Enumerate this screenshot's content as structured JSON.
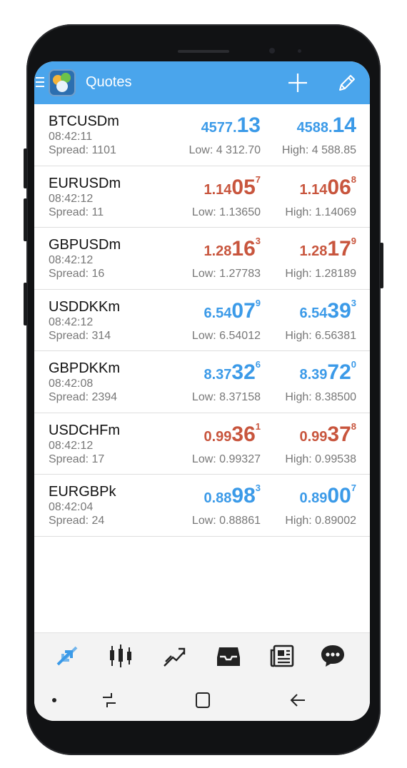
{
  "header": {
    "title": "Quotes",
    "menu_icon": "hamburger-icon",
    "logo_icon": "metatrader-logo-icon",
    "add_icon": "plus-icon",
    "edit_icon": "pencil-icon"
  },
  "colors": {
    "accent": "#4aa5ec",
    "up": "#3b9ae8",
    "down": "#c8553d"
  },
  "quotes": [
    {
      "symbol": "BTCUSDm",
      "time": "08:42:11",
      "spread": "Spread: 1101",
      "direction": "up",
      "bid": {
        "small": "4577.",
        "big": "13",
        "sup": ""
      },
      "ask": {
        "small": "4588.",
        "big": "14",
        "sup": ""
      },
      "low": "Low: 4 312.70",
      "high": "High: 4 588.85"
    },
    {
      "symbol": "EURUSDm",
      "time": "08:42:12",
      "spread": "Spread: 11",
      "direction": "down",
      "bid": {
        "small": "1.14",
        "big": "05",
        "sup": "7"
      },
      "ask": {
        "small": "1.14",
        "big": "06",
        "sup": "8"
      },
      "low": "Low: 1.13650",
      "high": "High: 1.14069"
    },
    {
      "symbol": "GBPUSDm",
      "time": "08:42:12",
      "spread": "Spread: 16",
      "direction": "down",
      "bid": {
        "small": "1.28",
        "big": "16",
        "sup": "3"
      },
      "ask": {
        "small": "1.28",
        "big": "17",
        "sup": "9"
      },
      "low": "Low: 1.27783",
      "high": "High: 1.28189"
    },
    {
      "symbol": "USDDKKm",
      "time": "08:42:12",
      "spread": "Spread: 314",
      "direction": "up",
      "bid": {
        "small": "6.54",
        "big": "07",
        "sup": "9"
      },
      "ask": {
        "small": "6.54",
        "big": "39",
        "sup": "3"
      },
      "low": "Low: 6.54012",
      "high": "High: 6.56381"
    },
    {
      "symbol": "GBPDKKm",
      "time": "08:42:08",
      "spread": "Spread: 2394",
      "direction": "up",
      "bid": {
        "small": "8.37",
        "big": "32",
        "sup": "6"
      },
      "ask": {
        "small": "8.39",
        "big": "72",
        "sup": "0"
      },
      "low": "Low: 8.37158",
      "high": "High: 8.38500"
    },
    {
      "symbol": "USDCHFm",
      "time": "08:42:12",
      "spread": "Spread: 17",
      "direction": "down",
      "bid": {
        "small": "0.99",
        "big": "36",
        "sup": "1"
      },
      "ask": {
        "small": "0.99",
        "big": "37",
        "sup": "8"
      },
      "low": "Low: 0.99327",
      "high": "High: 0.99538"
    },
    {
      "symbol": "EURGBPk",
      "time": "08:42:04",
      "spread": "Spread: 24",
      "direction": "up",
      "bid": {
        "small": "0.88",
        "big": "98",
        "sup": "3"
      },
      "ask": {
        "small": "0.89",
        "big": "00",
        "sup": "7"
      },
      "low": "Low: 0.88861",
      "high": "High: 0.89002"
    }
  ],
  "tabs": [
    {
      "icon": "quotes-arrows-icon",
      "active": true
    },
    {
      "icon": "candlestick-chart-icon",
      "active": false
    },
    {
      "icon": "trade-trend-icon",
      "active": false
    },
    {
      "icon": "history-inbox-icon",
      "active": false
    },
    {
      "icon": "news-icon",
      "active": false
    },
    {
      "icon": "chat-bubble-icon",
      "active": false
    }
  ],
  "system_nav": {
    "dot_icon": "dot-icon",
    "recent_icon": "recent-apps-icon",
    "home_icon": "home-icon",
    "back_icon": "back-icon"
  }
}
